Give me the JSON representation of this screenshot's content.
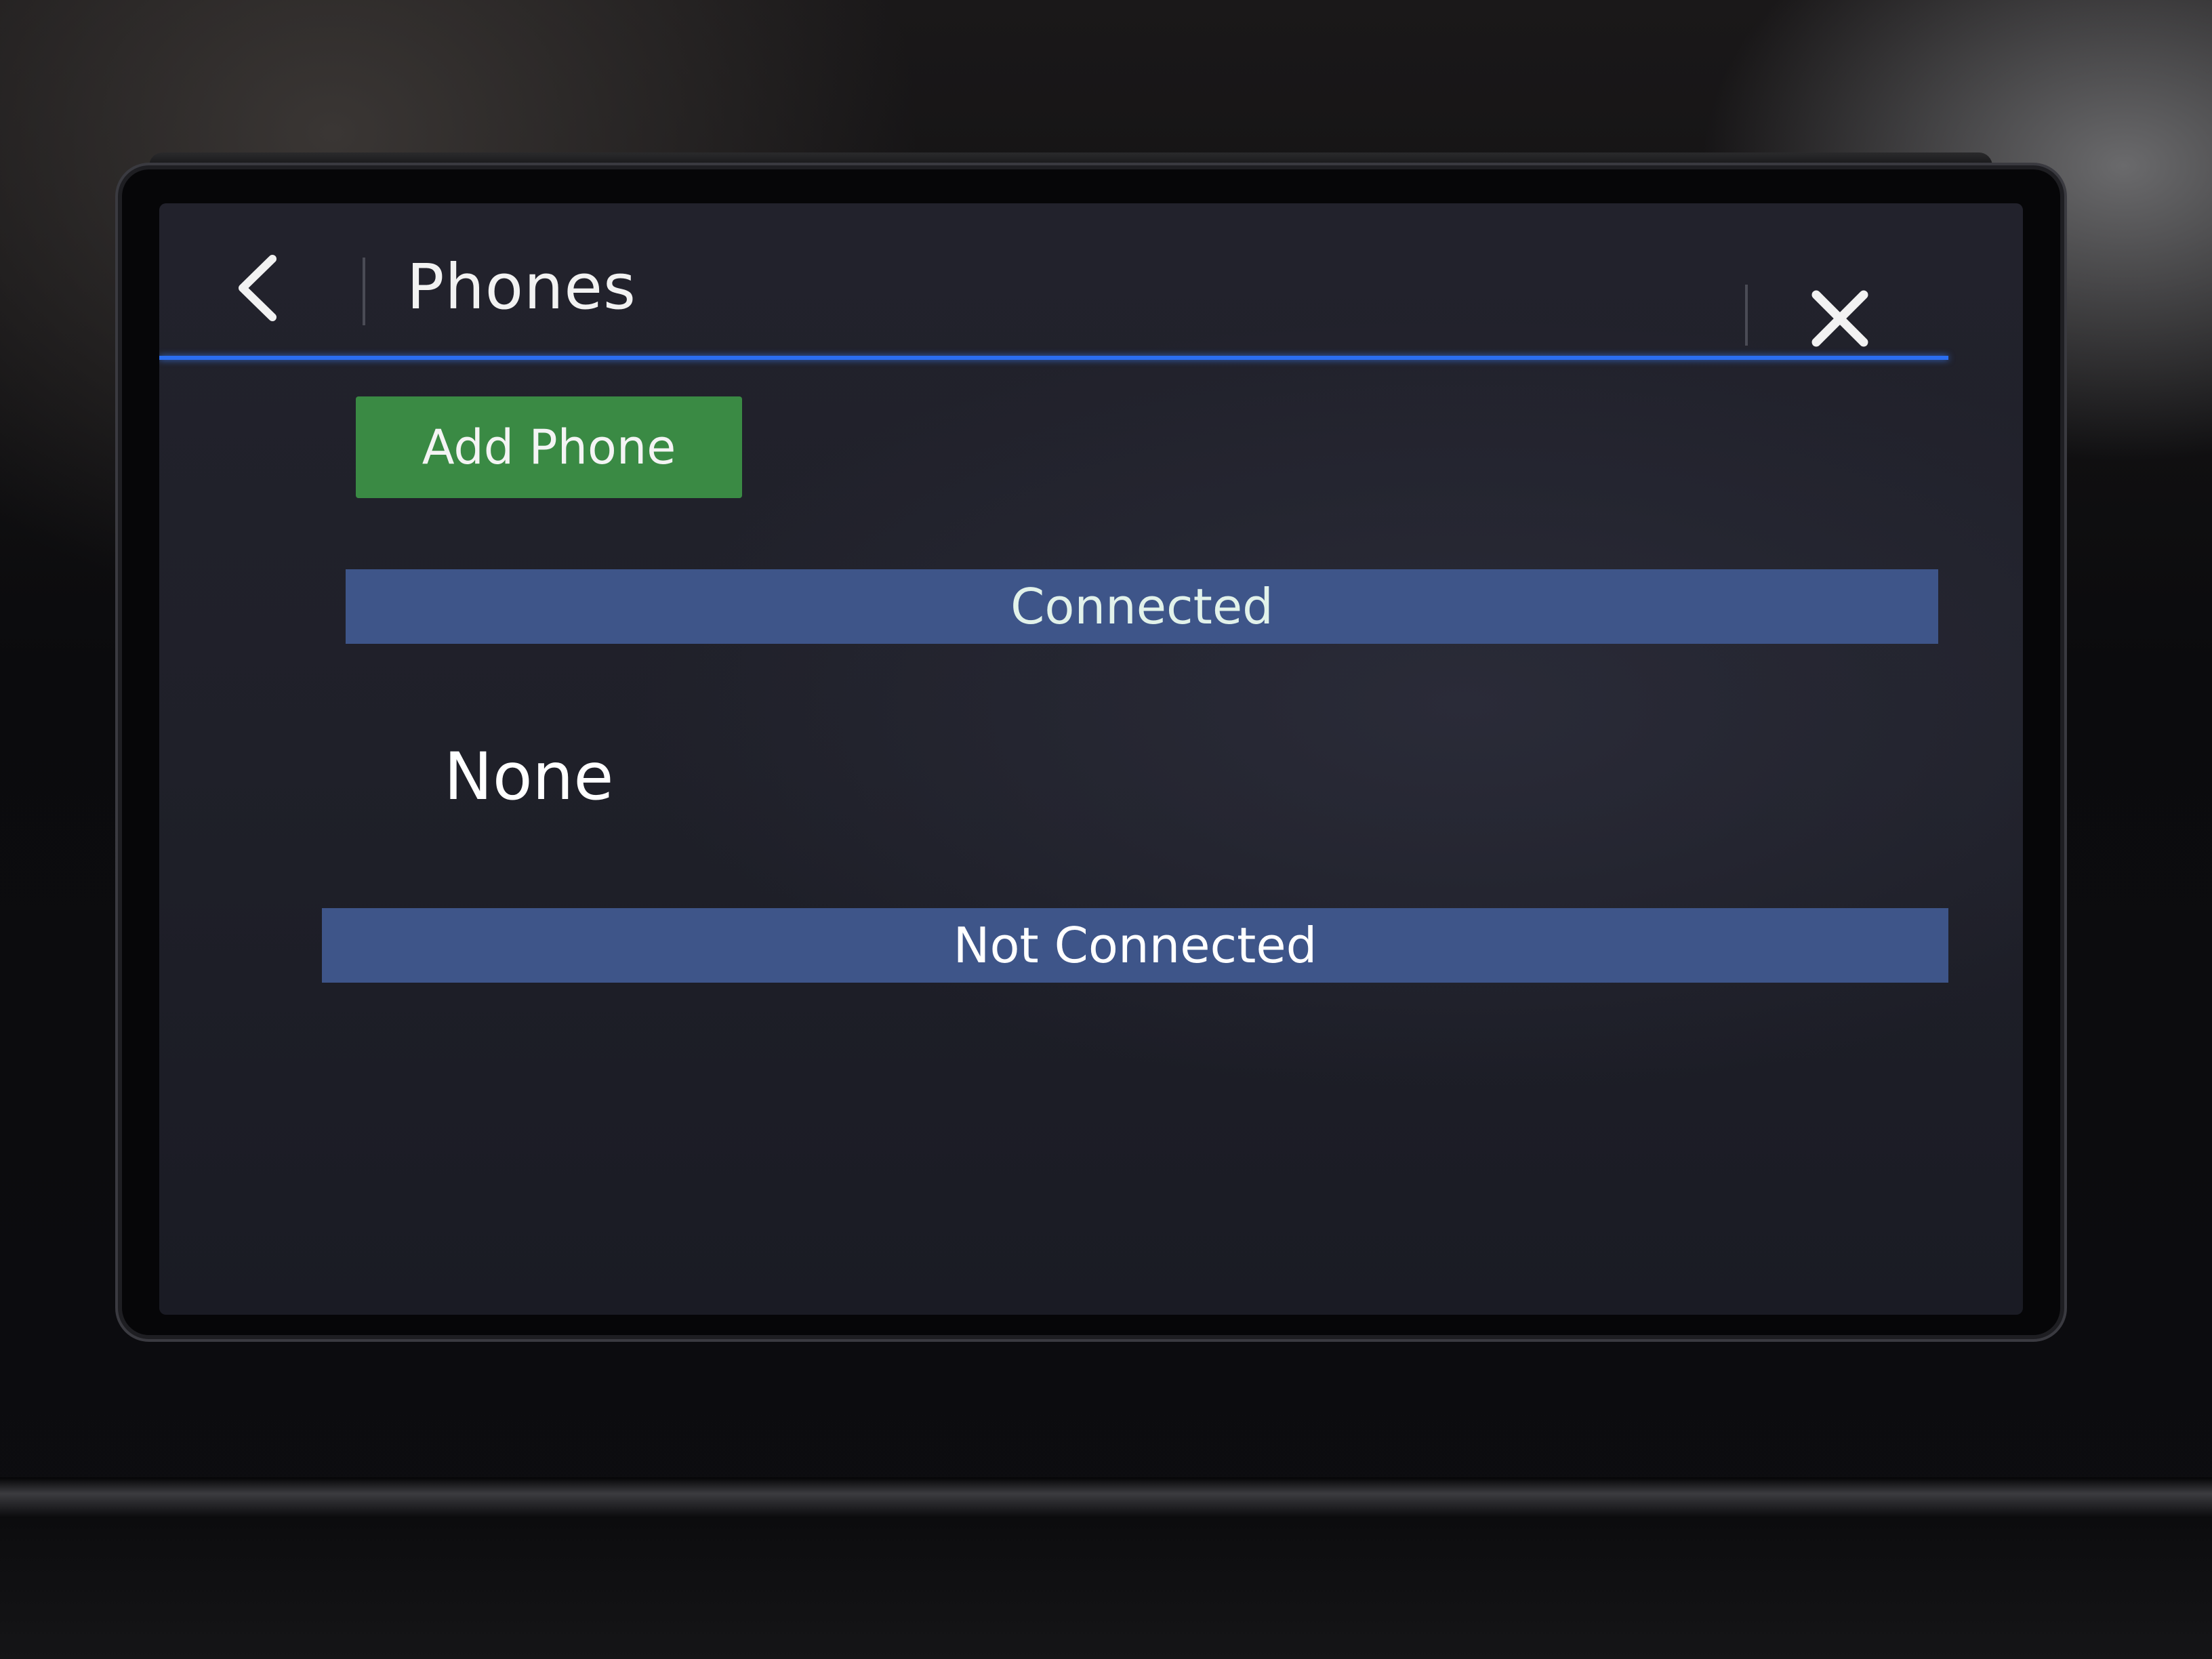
{
  "header": {
    "title": "Phones",
    "back_icon": "chevron-left-icon",
    "close_icon": "close-icon"
  },
  "actions": {
    "add_phone_label": "Add Phone"
  },
  "sections": {
    "connected": {
      "label": "Connected",
      "items": [
        "None"
      ]
    },
    "not_connected": {
      "label": "Not Connected",
      "items": []
    }
  },
  "colors": {
    "accent_line": "#2b6ef0",
    "add_button": "#3a8a44",
    "section_header": "#3e5589",
    "screen_background": "#1f2029"
  }
}
